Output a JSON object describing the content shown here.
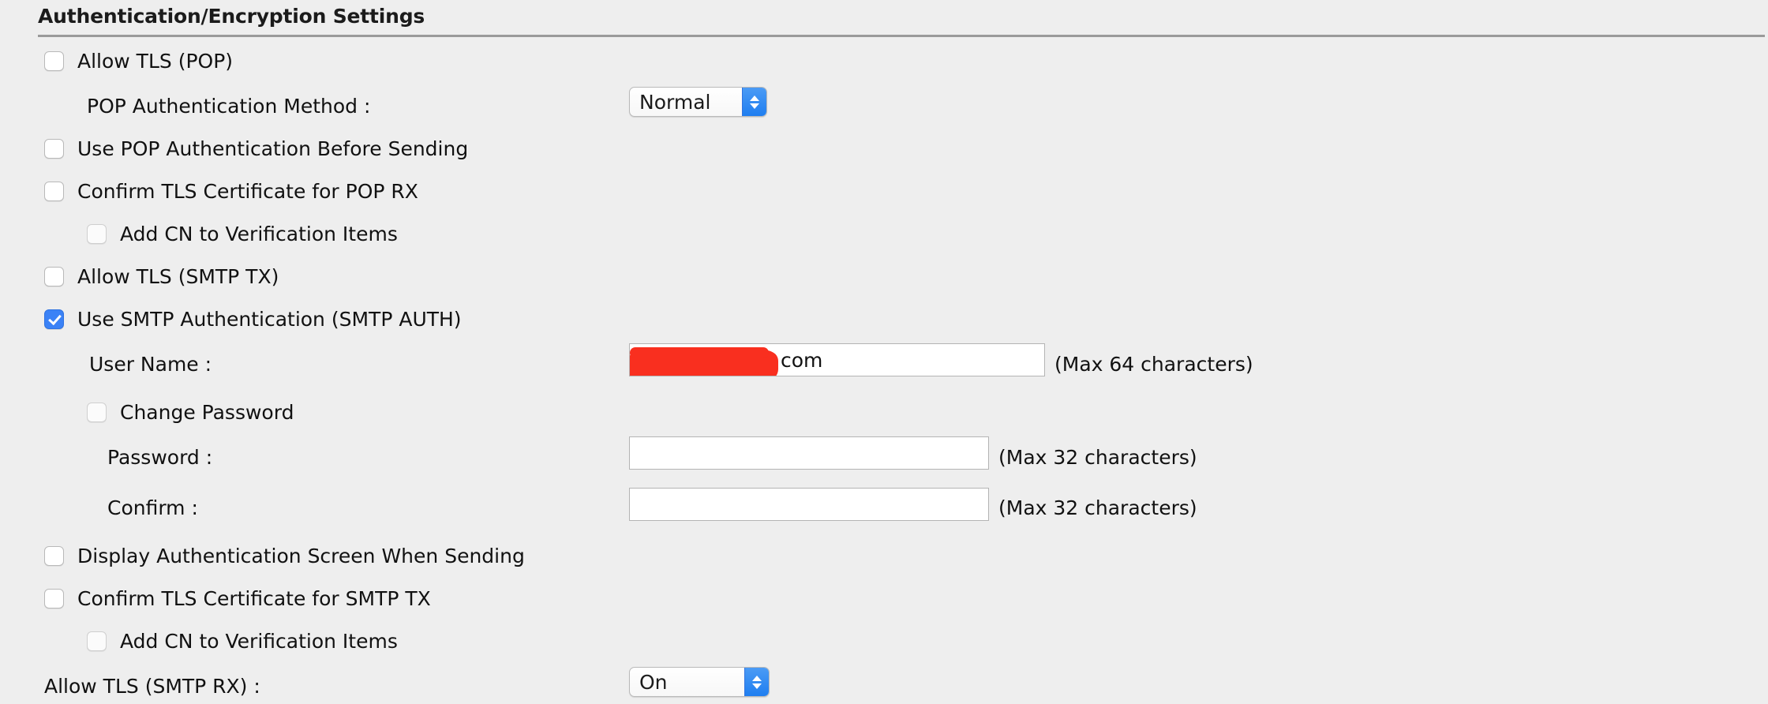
{
  "section": {
    "title": "Authentication/Encryption Settings"
  },
  "rows": {
    "allow_tls_pop": {
      "label": "Allow TLS (POP)",
      "checked": false
    },
    "pop_auth_method": {
      "label": "POP Authentication Method :",
      "value": "Normal",
      "options": [
        "Normal"
      ]
    },
    "use_pop_auth_before_sending": {
      "label": "Use POP Authentication Before Sending",
      "checked": false
    },
    "confirm_tls_cert_pop_rx": {
      "label": "Confirm TLS Certificate for POP RX",
      "checked": false
    },
    "add_cn_pop": {
      "label": "Add CN to Verification Items",
      "checked": false
    },
    "allow_tls_smtp_tx": {
      "label": "Allow TLS (SMTP TX)",
      "checked": false
    },
    "use_smtp_auth": {
      "label": "Use SMTP Authentication (SMTP AUTH)",
      "checked": true
    },
    "user_name": {
      "label": "User Name :",
      "value": "com",
      "redacted": true,
      "hint": "(Max 64 characters)"
    },
    "change_password": {
      "label": "Change Password",
      "checked": false
    },
    "password": {
      "label": "Password :",
      "value": "",
      "hint": "(Max 32 characters)"
    },
    "confirm": {
      "label": "Confirm :",
      "value": "",
      "hint": "(Max 32 characters)"
    },
    "display_auth_screen": {
      "label": "Display Authentication Screen When Sending",
      "checked": false
    },
    "confirm_tls_cert_smtp_tx": {
      "label": "Confirm TLS Certificate for SMTP TX",
      "checked": false
    },
    "add_cn_smtp": {
      "label": "Add CN to Verification Items",
      "checked": false
    },
    "allow_tls_smtp_rx": {
      "label": "Allow TLS (SMTP RX) :",
      "value": "On",
      "options": [
        "On"
      ]
    }
  },
  "colors": {
    "background": "#eeeeee",
    "accent_blue": "#3b82f6",
    "redaction_red": "#f92f1f",
    "rule_gray": "#9a9a9a"
  }
}
